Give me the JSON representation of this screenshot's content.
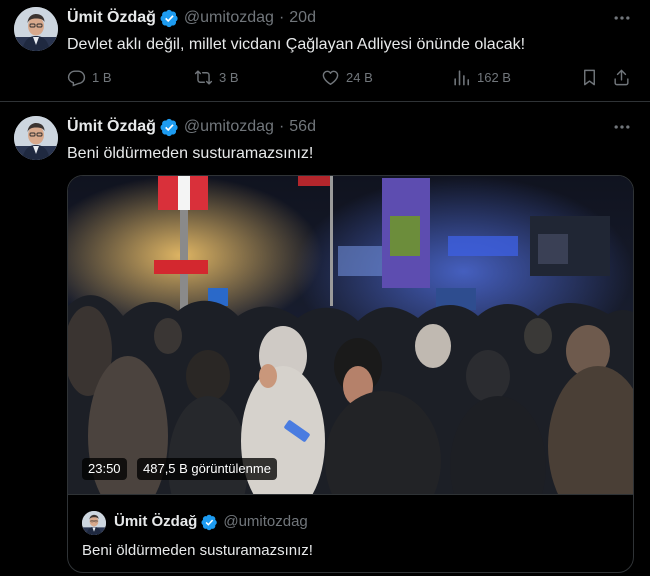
{
  "colors": {
    "background": "#000000",
    "text_primary": "#e7e9ea",
    "text_secondary": "#71767b",
    "divider": "#2f3336",
    "verified_blue": "#1d9bf0"
  },
  "tweets": [
    {
      "author_name": "Ümit Özdağ",
      "handle": "@umitozdag",
      "separator": "·",
      "time": "20d",
      "text": "Devlet aklı değil, millet vicdanı Çağlayan Adliyesi önünde olacak!",
      "actions": {
        "replies": "1 B",
        "retweets": "3 B",
        "likes": "24 B",
        "views": "162 B"
      },
      "icons": [
        "verified-badge-icon",
        "more-icon",
        "reply-icon",
        "retweet-icon",
        "like-icon",
        "views-icon",
        "bookmark-icon",
        "share-icon"
      ]
    },
    {
      "author_name": "Ümit Özdağ",
      "handle": "@umitozdag",
      "separator": "·",
      "time": "56d",
      "text": "Beni öldürmeden susturamazsınız!",
      "video": {
        "duration": "23:50",
        "views": "487,5 B görüntülenme"
      },
      "quote": {
        "author_name": "Ümit Özdağ",
        "handle": "@umitozdag",
        "text": "Beni öldürmeden susturamazsınız!"
      },
      "icons": [
        "verified-badge-icon",
        "more-icon"
      ]
    }
  ]
}
